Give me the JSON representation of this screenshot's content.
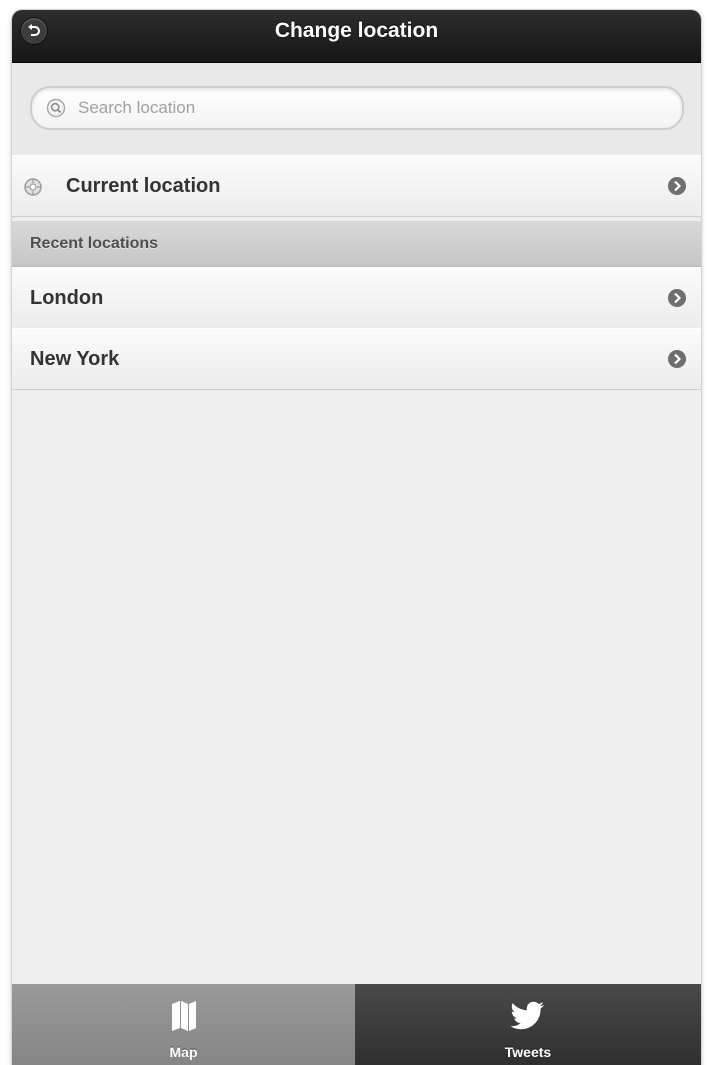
{
  "header": {
    "title": "Change location",
    "back_icon": "back-arrow-icon"
  },
  "search": {
    "placeholder": "Search location",
    "value": "",
    "icon": "search-icon"
  },
  "current_location": {
    "label": "Current location",
    "icon": "location-target-icon"
  },
  "recent": {
    "section_label": "Recent locations",
    "items": [
      {
        "label": "London"
      },
      {
        "label": "New York"
      }
    ]
  },
  "tabbar": {
    "tabs": [
      {
        "label": "Map",
        "icon": "map-icon",
        "selected": false
      },
      {
        "label": "Tweets",
        "icon": "twitter-bird-icon",
        "selected": true
      }
    ]
  },
  "colors": {
    "header_bg": "#1e1e1e",
    "row_text": "#333333",
    "tab_map_bg": "#8e8e8e",
    "tab_tweets_bg": "#3a3a3a"
  }
}
